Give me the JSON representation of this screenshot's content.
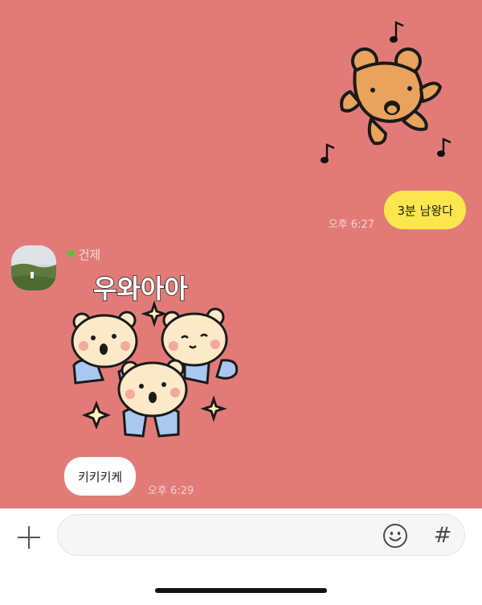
{
  "chat": {
    "background_color": "#e27b78",
    "messages": [
      {
        "sender": "me",
        "type": "sticker",
        "icon": "dancing-bear-with-music-notes"
      },
      {
        "sender": "me",
        "type": "text",
        "text": "3분 남왕다",
        "time": "오후 6:27",
        "bubble_color": "#fbe64d"
      },
      {
        "sender": "other",
        "type": "sticker",
        "icon": "three-cheering-bears",
        "caption": "우와아아"
      },
      {
        "sender": "other",
        "type": "text",
        "text": "키키키케",
        "time": "오후 6:29",
        "bubble_color": "#ffffff"
      }
    ],
    "other_user": {
      "name": "건제",
      "name_prefix_icon": "green-heart-icon",
      "avatar_icon": "landscape-photo-avatar"
    }
  },
  "input_bar": {
    "placeholder": "",
    "left_button_icon": "plus-icon",
    "emoji_button_icon": "smiley-icon",
    "hash_button_label": "#"
  }
}
